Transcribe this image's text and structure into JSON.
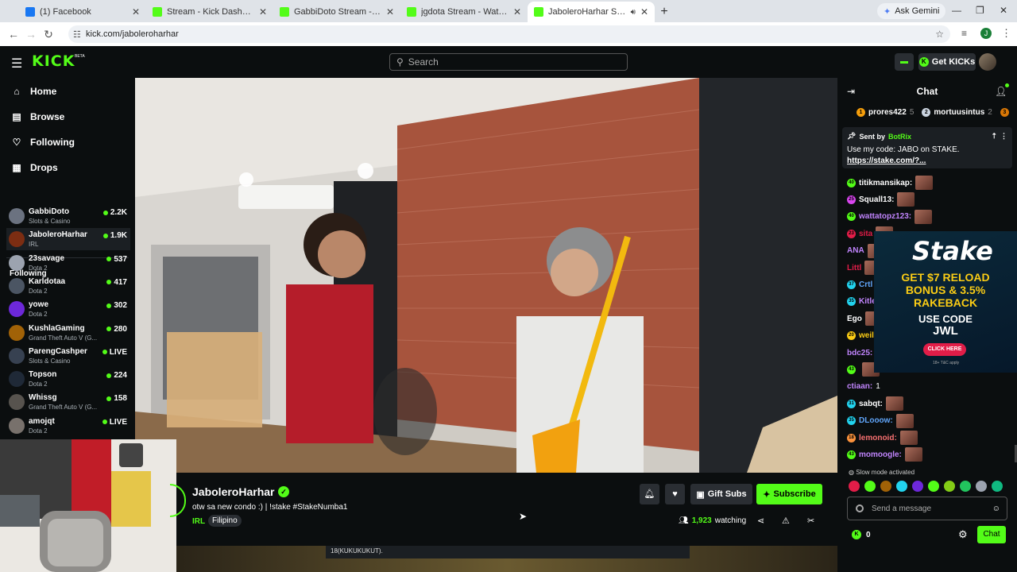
{
  "browser": {
    "tabs": [
      {
        "title": "(1) Facebook",
        "fav_color": "#1877f2",
        "active": false
      },
      {
        "title": "Stream - Kick Dashboard",
        "fav_color": "#53fc18",
        "active": false
      },
      {
        "title": "GabbiDoto Stream - Watch Live",
        "fav_color": "#53fc18",
        "active": false
      },
      {
        "title": "jgdota Stream - Watch Live on",
        "fav_color": "#53fc18",
        "active": false
      },
      {
        "title": "JaboleroHarhar Stream - W",
        "fav_color": "#53fc18",
        "active": true
      }
    ],
    "gemini_label": "Ask Gemini",
    "url": "kick.com/jaboleroharhar",
    "profile_initial": "J"
  },
  "header": {
    "logo": "KICK",
    "beta": "BETA",
    "search_placeholder": "Search",
    "get_kicks_label": "Get KICKs"
  },
  "sidebar": {
    "nav": [
      {
        "label": "Home",
        "icon": "home-icon"
      },
      {
        "label": "Browse",
        "icon": "browse-icon"
      },
      {
        "label": "Following",
        "icon": "heart-icon"
      },
      {
        "label": "Drops",
        "icon": "drops-icon"
      }
    ],
    "following_heading": "Following",
    "following": [
      {
        "name": "GabbiDoto",
        "category": "Slots & Casino",
        "viewers": "2.2K"
      },
      {
        "name": "JaboleroHarhar",
        "category": "IRL",
        "viewers": "1.9K"
      },
      {
        "name": "23savage",
        "category": "Dota 2",
        "viewers": "537"
      },
      {
        "name": "Karldotaa",
        "category": "Dota 2",
        "viewers": "417"
      },
      {
        "name": "yowe",
        "category": "Dota 2",
        "viewers": "302"
      },
      {
        "name": "KushlaGaming",
        "category": "Grand Theft Auto V (G...",
        "viewers": "280"
      },
      {
        "name": "ParengCashper",
        "category": "Slots & Casino",
        "viewers": "LIVE"
      },
      {
        "name": "Topson",
        "category": "Dota 2",
        "viewers": "224"
      },
      {
        "name": "Whissg",
        "category": "Grand Theft Auto V (G...",
        "viewers": "158"
      },
      {
        "name": "amojqt",
        "category": "Dota 2",
        "viewers": "LIVE"
      }
    ]
  },
  "stream": {
    "channel_name": "JaboleroHarhar",
    "title": "otw sa new condo :) | !stake #StakeNumba1",
    "category": "IRL",
    "tag": "Filipino",
    "gift_label": "Gift Subs",
    "subscribe_label": "Subscribe",
    "viewers": "1,923",
    "watching_label": "watching",
    "below_text": "18(KUKUKUKUT)."
  },
  "chat": {
    "title": "Chat",
    "leaderboard": [
      {
        "rank": "1",
        "name": "prores422",
        "count": "5"
      },
      {
        "rank": "2",
        "name": "mortuusintus",
        "count": "2"
      },
      {
        "rank": "3",
        "name": "",
        "count": ""
      }
    ],
    "pinned": {
      "sent_by_label": "Sent by",
      "sender": "BotRix",
      "message": "Use my code: JABO on STAKE.",
      "link": "https://stake.com/?..."
    },
    "messages": [
      {
        "badge": "40",
        "user": "titikmansikap:",
        "color": "#ffffff",
        "text": ""
      },
      {
        "badge": "25",
        "user": "Squall13:",
        "color": "#ffffff",
        "text": ""
      },
      {
        "badge": "40",
        "user": "wattatopz123:",
        "color": "#c084fc",
        "text": ""
      },
      {
        "badge": "23",
        "user": "sita",
        "color": "#e11d48",
        "text": ""
      },
      {
        "badge": "",
        "user": "ANA",
        "color": "#c084fc",
        "text": ""
      },
      {
        "badge": "",
        "user": "Littl",
        "color": "#e11d48",
        "text": ""
      },
      {
        "badge": "37",
        "user": "Crtl",
        "color": "#60a5fa",
        "text": ""
      },
      {
        "badge": "35",
        "user": "Kitle",
        "color": "#c084fc",
        "text": ""
      },
      {
        "badge": "",
        "user": "Ego",
        "color": "#ffffff",
        "text": ""
      },
      {
        "badge": "20",
        "user": "weil",
        "color": "#facc15",
        "text": ""
      },
      {
        "badge": "",
        "user": "bdc25:",
        "color": "#c084fc",
        "text": ""
      },
      {
        "badge": "43",
        "user": "",
        "color": "#ffffff",
        "text": ""
      },
      {
        "badge": "",
        "user": "ctiaan:",
        "color": "#c084fc",
        "text": "1"
      },
      {
        "badge": "31",
        "user": "sabqt:",
        "color": "#ffffff",
        "text": ""
      },
      {
        "badge": "35",
        "user": "DLooow:",
        "color": "#60a5fa",
        "text": ""
      },
      {
        "badge": "18",
        "user": "lemonoid:",
        "color": "#f87171",
        "text": ""
      },
      {
        "badge": "43",
        "user": "momoogle:",
        "color": "#c084fc",
        "text": ""
      }
    ],
    "ad": {
      "brand": "Stake",
      "line1": "GET $7 RELOAD",
      "line2": "BONUS & 3.5%",
      "line3": "RAKEBACK",
      "line4": "USE CODE",
      "code": "JWL",
      "cta": "CLICK HERE",
      "tc": "18+ T&C apply"
    },
    "slow_mode": "Slow mode activated",
    "input_placeholder": "Send a message",
    "kicks_count": "0",
    "chat_button": "Chat"
  },
  "colors": {
    "brand": "#53fc18",
    "bg": "#0b0e0f",
    "panel": "#1b1f23"
  }
}
